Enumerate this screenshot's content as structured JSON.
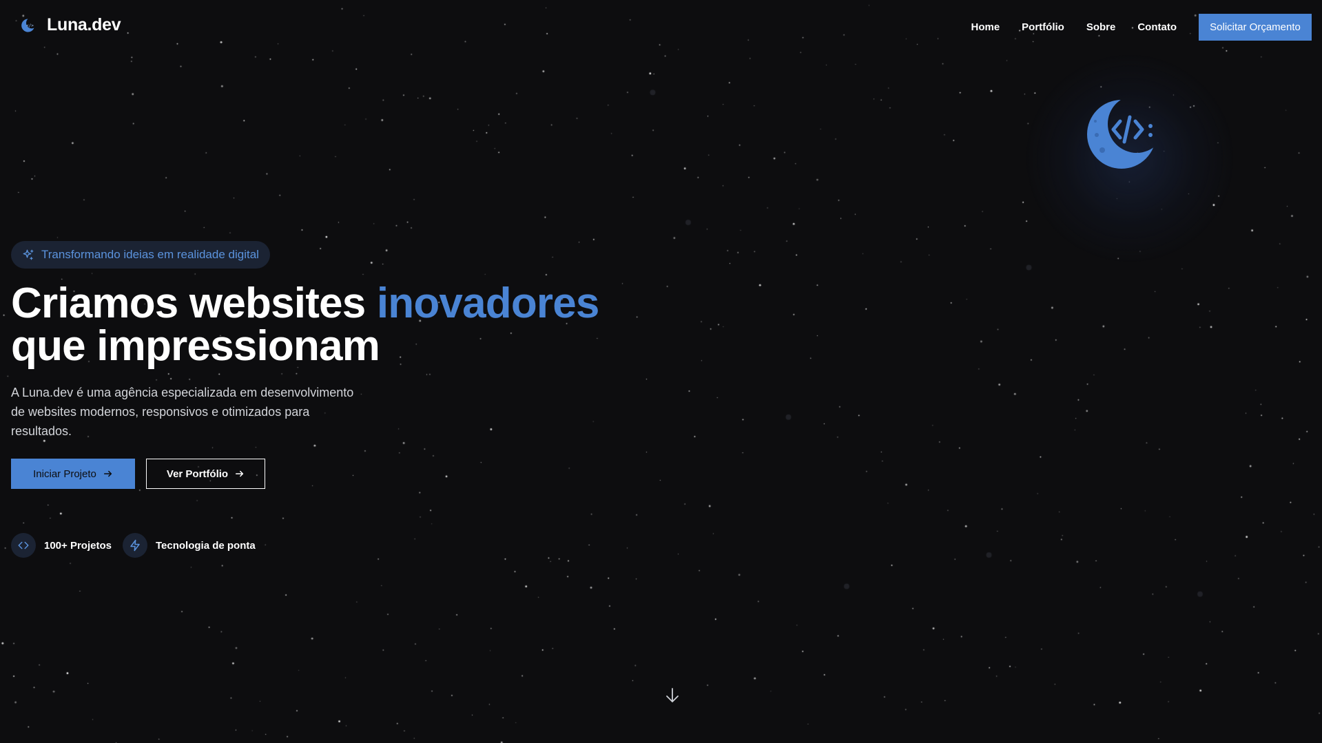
{
  "brand": {
    "name": "Luna.dev",
    "logo_icon": "crescent-moon-code-icon"
  },
  "nav": {
    "items": [
      {
        "label": "Home"
      },
      {
        "label": "Portfólio"
      },
      {
        "label": "Sobre"
      },
      {
        "label": "Contato"
      }
    ],
    "cta_label": "Solicitar Orçamento"
  },
  "hero": {
    "badge_icon": "sparkles-icon",
    "badge_text": "Transformando ideias em realidade digital",
    "headline_part1": "Criamos websites ",
    "headline_accent": "inovadores",
    "headline_part2": "que impressionam",
    "lead": "A Luna.dev é uma agência especializada em desenvolvimento de websites modernos, responsivos e otimizados para resultados.",
    "primary_button": "Iniciar Projeto",
    "secondary_button": "Ver Portfólio",
    "features": [
      {
        "icon": "code-icon",
        "label": "100+ Projetos"
      },
      {
        "icon": "lightning-icon",
        "label": "Tecnologia de ponta"
      }
    ],
    "emblem_icon": "crescent-moon-code-icon",
    "scroll_icon": "arrow-down-icon"
  },
  "theme": {
    "background": "#0d0d0f",
    "accent": "#4a84d4",
    "badge_bg": "#1b2333",
    "text": "#ffffff",
    "muted_text": "#d2d4d9"
  }
}
